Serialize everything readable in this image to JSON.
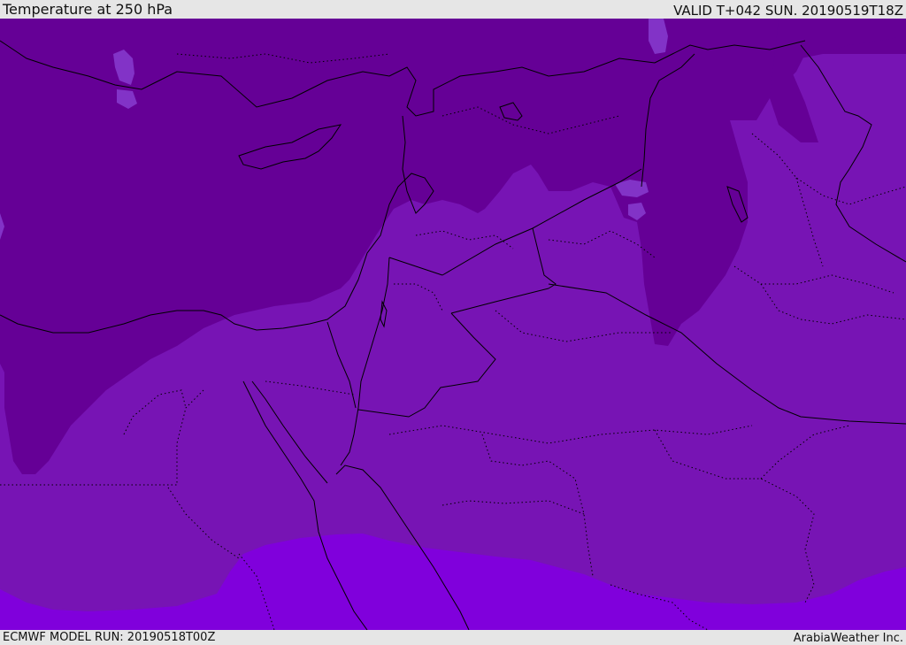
{
  "header": {
    "title": "Temperature at 250 hPa",
    "valid_time": "VALID T+042 SUN. 20190519T18Z"
  },
  "footer": {
    "model_run": "ECMWF MODEL RUN: 20190518T00Z",
    "credit": "ArabiaWeather Inc."
  },
  "colors": {
    "dark_band": "#650096",
    "mid_band": "#7714b4",
    "warm_band": "#8000dc",
    "light_band": "#8233c7"
  }
}
